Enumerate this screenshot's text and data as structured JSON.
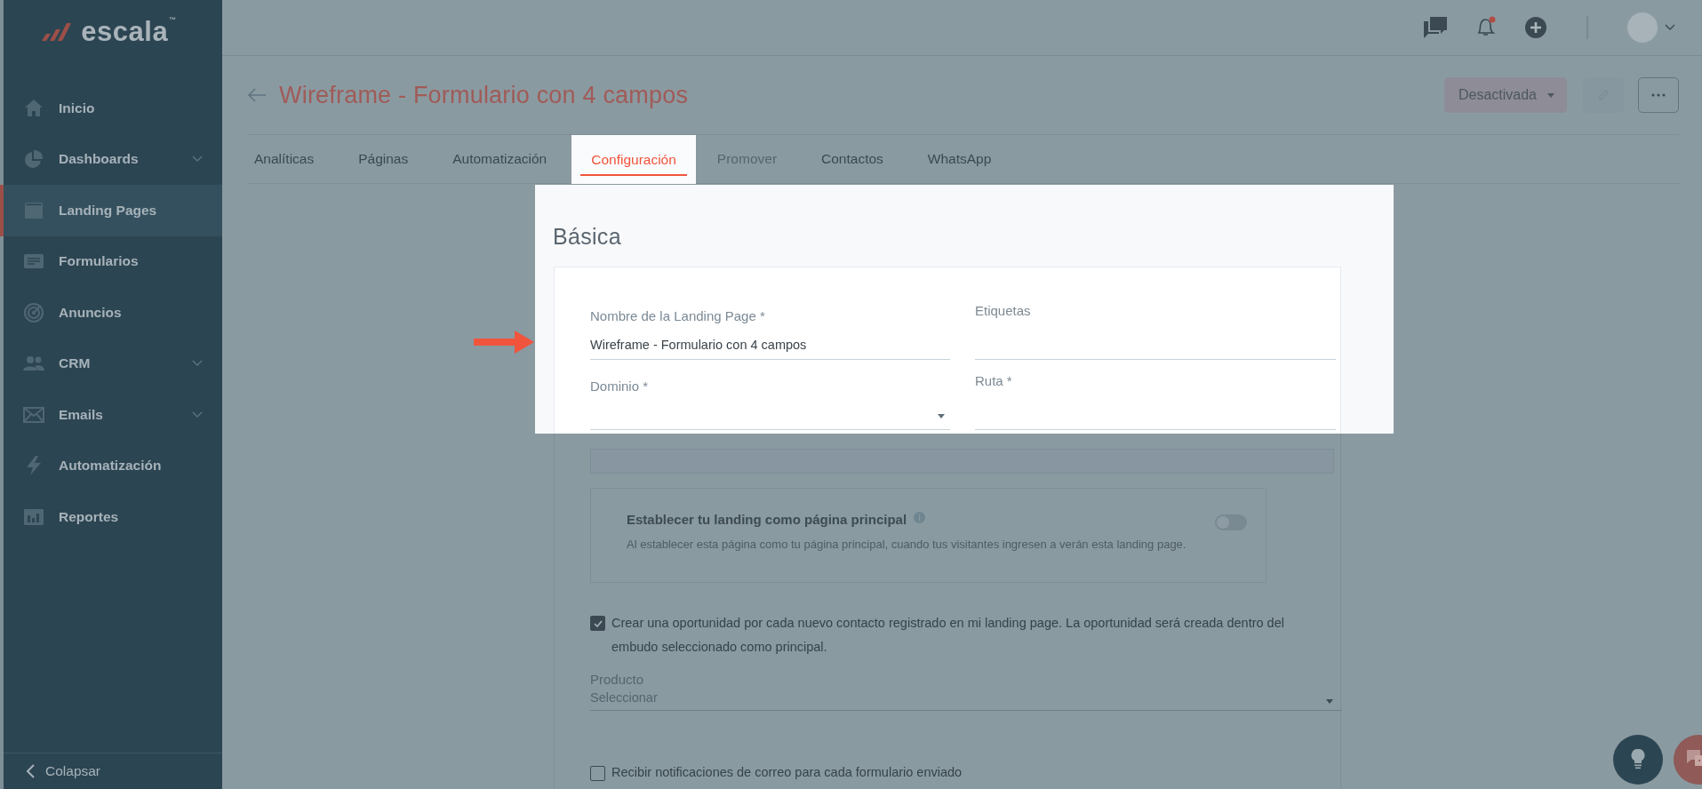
{
  "logo": {
    "text": "escala",
    "trademark": "™"
  },
  "sidebar": {
    "items": [
      {
        "label": "Inicio",
        "expandable": false,
        "selected": false
      },
      {
        "label": "Dashboards",
        "expandable": true,
        "selected": false
      },
      {
        "label": "Landing Pages",
        "expandable": false,
        "selected": true
      },
      {
        "label": "Formularios",
        "expandable": false,
        "selected": false
      },
      {
        "label": "Anuncios",
        "expandable": false,
        "selected": false
      },
      {
        "label": "CRM",
        "expandable": true,
        "selected": false
      },
      {
        "label": "Emails",
        "expandable": true,
        "selected": false
      },
      {
        "label": "Automatización",
        "expandable": false,
        "selected": false
      },
      {
        "label": "Reportes",
        "expandable": false,
        "selected": false
      }
    ],
    "collapse": "Colapsar"
  },
  "page": {
    "title": "Wireframe - Formulario con 4 campos",
    "status_button": "Desactivada",
    "tabs": [
      {
        "label": "Analíticas",
        "selected": false,
        "disabled": false
      },
      {
        "label": "Páginas",
        "selected": false,
        "disabled": false
      },
      {
        "label": "Automatización",
        "selected": false,
        "disabled": false
      },
      {
        "label": "Configuración",
        "selected": true,
        "disabled": false
      },
      {
        "label": "Promover",
        "selected": false,
        "disabled": true
      },
      {
        "label": "Contactos",
        "selected": false,
        "disabled": false
      },
      {
        "label": "WhatsApp",
        "selected": false,
        "disabled": false
      }
    ]
  },
  "form": {
    "section_title": "Básica",
    "fields": [
      {
        "label": "Nombre de la Landing Page *",
        "kind": "text",
        "value": "Wireframe - Formulario con 4 campos"
      },
      {
        "label": "Etiquetas",
        "kind": "text"
      },
      {
        "label": "Dominio *",
        "kind": "select"
      },
      {
        "label": "Ruta *",
        "kind": "text"
      }
    ],
    "homepage": {
      "title": "Establecer tu landing como página principal",
      "description": "Al establecer esta página como tu página principal, cuando tus visitantes ingresen a verán esta landing page.",
      "on": false
    },
    "opportunity": {
      "checked": true,
      "text": "Crear una oportunidad por cada nuevo contacto registrado en mi landing page. La oportunidad será creada dentro del embudo seleccionado como principal."
    },
    "product": {
      "label": "Producto",
      "placeholder": "Seleccionar"
    },
    "notifications": {
      "checked": false,
      "text": "Recibir notificaciones de correo para cada formulario enviado"
    }
  }
}
